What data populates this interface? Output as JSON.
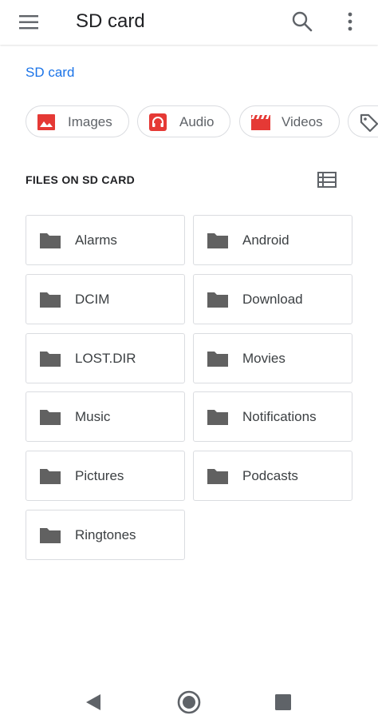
{
  "app_bar": {
    "title": "SD card",
    "menu_icon": "hamburger-menu-icon",
    "search_icon": "search-icon",
    "more_icon": "more-vert-icon"
  },
  "breadcrumb": {
    "label": "SD card",
    "color": "#1a73e8"
  },
  "chips": [
    {
      "label": "Images",
      "icon": "image-icon",
      "color": "#e53935"
    },
    {
      "label": "Audio",
      "icon": "headphones-icon",
      "color": "#e53935"
    },
    {
      "label": "Videos",
      "icon": "movie-clapper-icon",
      "color": "#e53935"
    },
    {
      "label": "",
      "icon": "tag-icon",
      "color": "#5f6368"
    }
  ],
  "section": {
    "title": "FILES ON SD CARD",
    "view_toggle_icon": "list-view-icon"
  },
  "folders": [
    {
      "name": "Alarms"
    },
    {
      "name": "Android"
    },
    {
      "name": "DCIM"
    },
    {
      "name": "Download"
    },
    {
      "name": "LOST.DIR"
    },
    {
      "name": "Movies"
    },
    {
      "name": "Music"
    },
    {
      "name": "Notifications"
    },
    {
      "name": "Pictures"
    },
    {
      "name": "Podcasts"
    },
    {
      "name": "Ringtones"
    }
  ],
  "folder_icon_color": "#616161",
  "nav_bar": {
    "back_icon": "nav-back-icon",
    "home_icon": "nav-home-icon",
    "recents_icon": "nav-recents-icon"
  }
}
